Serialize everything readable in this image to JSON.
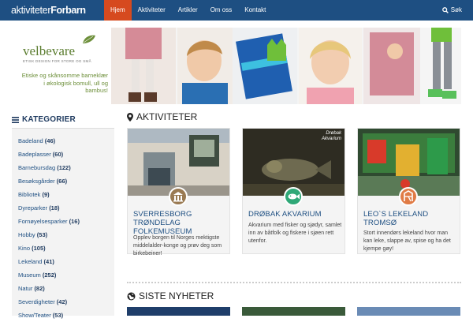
{
  "header": {
    "logo_part1": "aktiviteter",
    "logo_part2": "Forbarn",
    "nav": [
      {
        "label": "Hjem",
        "active": true
      },
      {
        "label": "Aktiviteter"
      },
      {
        "label": "Artikler"
      },
      {
        "label": "Om oss"
      },
      {
        "label": "Kontakt"
      }
    ],
    "search_label": "Søk",
    "accent_color": "#1e4f82",
    "active_color": "#d64a1f"
  },
  "banner": {
    "brand": "velbevare",
    "tagline": "ETISK DESIGN FOR STORE OG SMÅ",
    "description": "Etiske og skånsomme barneklær i økologisk bomull, ull og bambus!"
  },
  "sidebar": {
    "title": "KATEGORIER",
    "items": [
      {
        "name": "Badeland",
        "count": "(46)"
      },
      {
        "name": "Badeplasser",
        "count": "(60)"
      },
      {
        "name": "Barnebursdag",
        "count": "(122)"
      },
      {
        "name": "Besøksgårder",
        "count": "(66)"
      },
      {
        "name": "Bibliotek",
        "count": "(9)"
      },
      {
        "name": "Dyreparker",
        "count": "(18)"
      },
      {
        "name": "Fornøyelsesparker",
        "count": "(16)"
      },
      {
        "name": "Hobby",
        "count": "(53)"
      },
      {
        "name": "Kino",
        "count": "(105)"
      },
      {
        "name": "Lekeland",
        "count": "(41)"
      },
      {
        "name": "Museum",
        "count": "(252)"
      },
      {
        "name": "Natur",
        "count": "(82)"
      },
      {
        "name": "Severdigheter",
        "count": "(42)"
      },
      {
        "name": "Show/Teater",
        "count": "(53)"
      }
    ]
  },
  "activities": {
    "title": "AKTIVITETER",
    "cards": [
      {
        "title": "SVERRESBORG TRØNDELAG FOLKEMUSEUM",
        "text": "Opplev borgen til Norges mektigste middelalder-konge og prøv deg som birkebeiner!",
        "badge_color": "#9a7a52",
        "icon": "museum-icon"
      },
      {
        "title": "DRØBAK AKVARIUM",
        "text": "Akvarium med fisker og sjødyr, samlet inn av båtfolk og fiskere i sjøen rett utenfor.",
        "badge_color": "#2fa877",
        "icon": "fish-icon",
        "overlay": "Drøbak Akvarium"
      },
      {
        "title": "LEO`S LEKELAND TROMSØ",
        "text": "Stort innendørs lekeland hvor man kan leke, slappe av, spise og ha det kjempe gøy!",
        "badge_color": "#e07b45",
        "icon": "playground-icon"
      }
    ]
  },
  "news": {
    "title": "SISTE NYHETER"
  }
}
